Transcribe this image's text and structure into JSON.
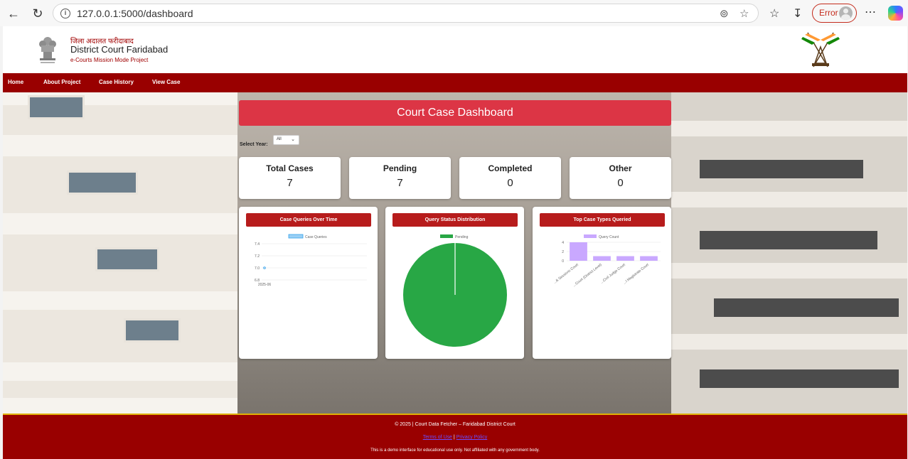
{
  "browser": {
    "url": "127.0.0.1:5000/dashboard",
    "error_label": "Error",
    "back_icon": "back-arrow-icon",
    "reload_icon": "reload-icon"
  },
  "header": {
    "hindi_title": "जिला अदालत फरीदाबाद",
    "court_name": "District Court Faridabad",
    "mission": "e-Courts Mission Mode Project"
  },
  "nav": {
    "items": [
      {
        "label": "Home"
      },
      {
        "label": "About Project"
      },
      {
        "label": "Case History"
      },
      {
        "label": "View Case"
      }
    ]
  },
  "dashboard": {
    "title": "Court Case Dashboard",
    "year_label": "Select Year:",
    "year_value": "All",
    "stats": [
      {
        "label": "Total Cases",
        "value": "7"
      },
      {
        "label": "Pending",
        "value": "7"
      },
      {
        "label": "Completed",
        "value": "0"
      },
      {
        "label": "Other",
        "value": "0"
      }
    ]
  },
  "colors": {
    "brand_red": "#990000",
    "title_red": "#dc3545",
    "pie_green": "#28a745",
    "bar_purple": "#c9a8ff",
    "line_blue": "#9ad0f5"
  },
  "chart_data": [
    {
      "type": "line",
      "title": "Case Queries Over Time",
      "legend": "top",
      "series": [
        {
          "name": "Case Queries",
          "x": [
            "2025-06"
          ],
          "values": [
            7
          ]
        }
      ],
      "y_ticks": [
        "7.4",
        "7.2",
        "7.0",
        "6.8"
      ],
      "ylim": [
        6.8,
        7.4
      ]
    },
    {
      "type": "pie",
      "title": "Query Status Distribution",
      "legend": "top",
      "labels": [
        "Pending"
      ],
      "values": [
        7
      ]
    },
    {
      "type": "bar",
      "title": "Top Case Types Queried",
      "legend": "top",
      "series": [
        {
          "name": "Query Count",
          "values": [
            4,
            1,
            1,
            1
          ]
        }
      ],
      "categories": [
        "...& Sessions Court",
        "...Court (District Level)",
        "...Civil Judge Court",
        "...l Magistrate Court"
      ],
      "y_ticks": [
        "4",
        "2",
        "0"
      ],
      "ylim": [
        0,
        4
      ]
    }
  ],
  "footer": {
    "copyright": "© 2025 | Court Data Fetcher – Faridabad District Court",
    "terms": "Terms of Use",
    "separator": "|",
    "privacy": "Privacy Policy",
    "disclaimer": "This is a demo interface for educational use only. Not affiliated with any government body."
  }
}
